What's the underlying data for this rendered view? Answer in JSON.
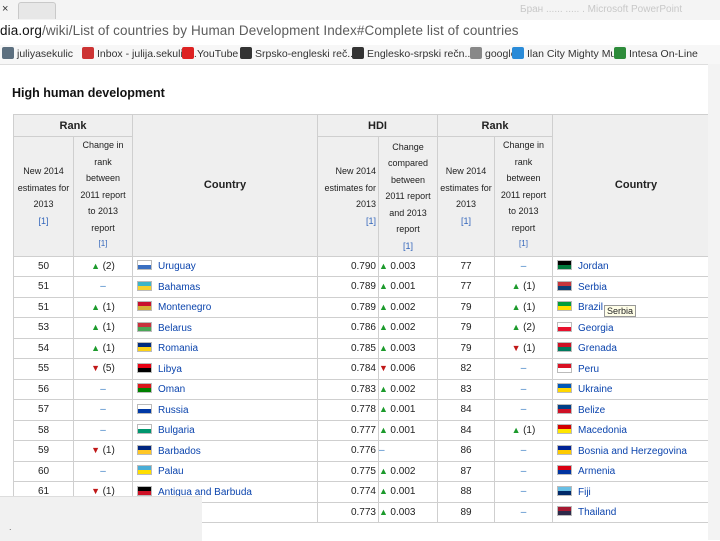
{
  "browser": {
    "close_glyph": "×",
    "faded_title": "Бран ...... ..... . Microsoft PowerPoint",
    "url_host": "dia.org",
    "url_path": "/wiki/List of countries by Human Development Index#Complete list of countries"
  },
  "bookmarks": [
    {
      "label": "juliyasekulic",
      "icon": "wordpress-icon",
      "color": "#5c6f7f"
    },
    {
      "label": "Inbox - julija.sekulic...",
      "icon": "gmail-icon",
      "color": "#c33"
    },
    {
      "label": "YouTube",
      "icon": "youtube-icon",
      "color": "#d22"
    },
    {
      "label": "Srpsko-engleski reč...",
      "icon": "k-icon",
      "color": "#333"
    },
    {
      "label": "Englesko-srpski rečn...",
      "icon": "k-icon",
      "color": "#333"
    },
    {
      "label": "google",
      "icon": "page-icon",
      "color": "#888"
    },
    {
      "label": "Ilan City Mighty Mu...",
      "icon": "jimdo-icon",
      "color": "#2a8bd8"
    },
    {
      "label": "Intesa On-Line",
      "icon": "bank-icon",
      "color": "#2d8b3a"
    }
  ],
  "page": {
    "section_title": "High human development"
  },
  "table": {
    "group_rank": "Rank",
    "group_hdi": "HDI",
    "sub_new_estimates": [
      "New 2014",
      "estimates for",
      "2013"
    ],
    "sub_change_rank": [
      "Change in",
      "rank",
      "between",
      "2011 report",
      "to 2013",
      "report"
    ],
    "sub_change_rank_right": [
      "Change in",
      "rank",
      "between",
      "2011 report",
      "to 2013",
      "report"
    ],
    "sub_change_hdi": [
      "Change",
      "compared",
      "between",
      "2011 report",
      "and 2013",
      "report"
    ],
    "ref": "[1]",
    "country_header": "Country",
    "rows": [
      {
        "rank": "50",
        "chg": "(2)",
        "dir": "up",
        "country": "Uruguay",
        "hdi": "0.790",
        "hchg": "0.003",
        "hdir": "up",
        "rank2": "77",
        "chg2": "–",
        "dir2": "eq",
        "country2": "Jordan"
      },
      {
        "rank": "51",
        "chg": "–",
        "dir": "eq",
        "country": "Bahamas",
        "hdi": "0.789",
        "hchg": "0.001",
        "hdir": "up",
        "rank2": "77",
        "chg2": "(1)",
        "dir2": "up",
        "country2": "Serbia"
      },
      {
        "rank": "51",
        "chg": "(1)",
        "dir": "up",
        "country": "Montenegro",
        "hdi": "0.789",
        "hchg": "0.002",
        "hdir": "up",
        "rank2": "79",
        "chg2": "(1)",
        "dir2": "up",
        "country2": "Brazil"
      },
      {
        "rank": "53",
        "chg": "(1)",
        "dir": "up",
        "country": "Belarus",
        "hdi": "0.786",
        "hchg": "0.002",
        "hdir": "up",
        "rank2": "79",
        "chg2": "(2)",
        "dir2": "up",
        "country2": "Georgia"
      },
      {
        "rank": "54",
        "chg": "(1)",
        "dir": "up",
        "country": "Romania",
        "hdi": "0.785",
        "hchg": "0.003",
        "hdir": "up",
        "rank2": "79",
        "chg2": "(1)",
        "dir2": "dn",
        "country2": "Grenada"
      },
      {
        "rank": "55",
        "chg": "(5)",
        "dir": "dn",
        "country": "Libya",
        "hdi": "0.784",
        "hchg": "0.006",
        "hdir": "dn",
        "rank2": "82",
        "chg2": "–",
        "dir2": "eq",
        "country2": "Peru"
      },
      {
        "rank": "56",
        "chg": "–",
        "dir": "eq",
        "country": "Oman",
        "hdi": "0.783",
        "hchg": "0.002",
        "hdir": "up",
        "rank2": "83",
        "chg2": "–",
        "dir2": "eq",
        "country2": "Ukraine"
      },
      {
        "rank": "57",
        "chg": "–",
        "dir": "eq",
        "country": "Russia",
        "hdi": "0.778",
        "hchg": "0.001",
        "hdir": "up",
        "rank2": "84",
        "chg2": "–",
        "dir2": "eq",
        "country2": "Belize"
      },
      {
        "rank": "58",
        "chg": "–",
        "dir": "eq",
        "country": "Bulgaria",
        "hdi": "0.777",
        "hchg": "0.001",
        "hdir": "up",
        "rank2": "84",
        "chg2": "(1)",
        "dir2": "up",
        "country2": "Macedonia"
      },
      {
        "rank": "59",
        "chg": "(1)",
        "dir": "dn",
        "country": "Barbados",
        "hdi": "0.776",
        "hchg": "–",
        "hdir": "eq",
        "rank2": "86",
        "chg2": "–",
        "dir2": "eq",
        "country2": "Bosnia and Herzegovina"
      },
      {
        "rank": "60",
        "chg": "–",
        "dir": "eq",
        "country": "Palau",
        "hdi": "0.775",
        "hchg": "0.002",
        "hdir": "up",
        "rank2": "87",
        "chg2": "–",
        "dir2": "eq",
        "country2": "Armenia"
      },
      {
        "rank": "61",
        "chg": "(1)",
        "dir": "dn",
        "country": "Antigua and Barbuda",
        "hdi": "0.774",
        "hchg": "0.001",
        "hdir": "up",
        "rank2": "88",
        "chg2": "–",
        "dir2": "eq",
        "country2": "Fiji"
      },
      {
        "rank": "",
        "chg": "",
        "dir": "none",
        "country": "",
        "hdi": "0.773",
        "hchg": "0.003",
        "hdir": "up",
        "rank2": "89",
        "chg2": "–",
        "dir2": "eq",
        "country2": "Thailand"
      }
    ]
  },
  "flags": {
    "Uruguay": [
      "#fff",
      "#3a6fc1"
    ],
    "Bahamas": [
      "#3bb4c8",
      "#f5d12c"
    ],
    "Montenegro": [
      "#c8102e",
      "#d4af37"
    ],
    "Belarus": [
      "#c8313e",
      "#4aa657"
    ],
    "Romania": [
      "#002b7f",
      "#fcd116"
    ],
    "Libya": [
      "#e70013",
      "#000"
    ],
    "Oman": [
      "#db161b",
      "#008000"
    ],
    "Russia": [
      "#fff",
      "#0039a6"
    ],
    "Bulgaria": [
      "#fff",
      "#00966e"
    ],
    "Barbados": [
      "#00267f",
      "#ffc726"
    ],
    "Palau": [
      "#4aadd6",
      "#ffde00"
    ],
    "Antigua and Barbuda": [
      "#000",
      "#ce1126"
    ],
    "Jordan": [
      "#000",
      "#007a3d"
    ],
    "Serbia": [
      "#c6363c",
      "#0c4076"
    ],
    "Brazil": [
      "#009c3b",
      "#ffdf00"
    ],
    "Georgia": [
      "#fff",
      "#e8112d"
    ],
    "Grenada": [
      "#ce1126",
      "#007a5e"
    ],
    "Peru": [
      "#d91023",
      "#fff"
    ],
    "Ukraine": [
      "#0057b7",
      "#ffd700"
    ],
    "Belize": [
      "#003f87",
      "#ce1126"
    ],
    "Macedonia": [
      "#d20000",
      "#ffe600"
    ],
    "Bosnia and Herzegovina": [
      "#002395",
      "#fecb00"
    ],
    "Armenia": [
      "#d90012",
      "#0033a0"
    ],
    "Fiji": [
      "#68bfe5",
      "#002868"
    ],
    "Thailand": [
      "#a51931",
      "#2d2a4a"
    ]
  },
  "tooltip": "Serbia",
  "overlay": {
    "dot": "."
  }
}
